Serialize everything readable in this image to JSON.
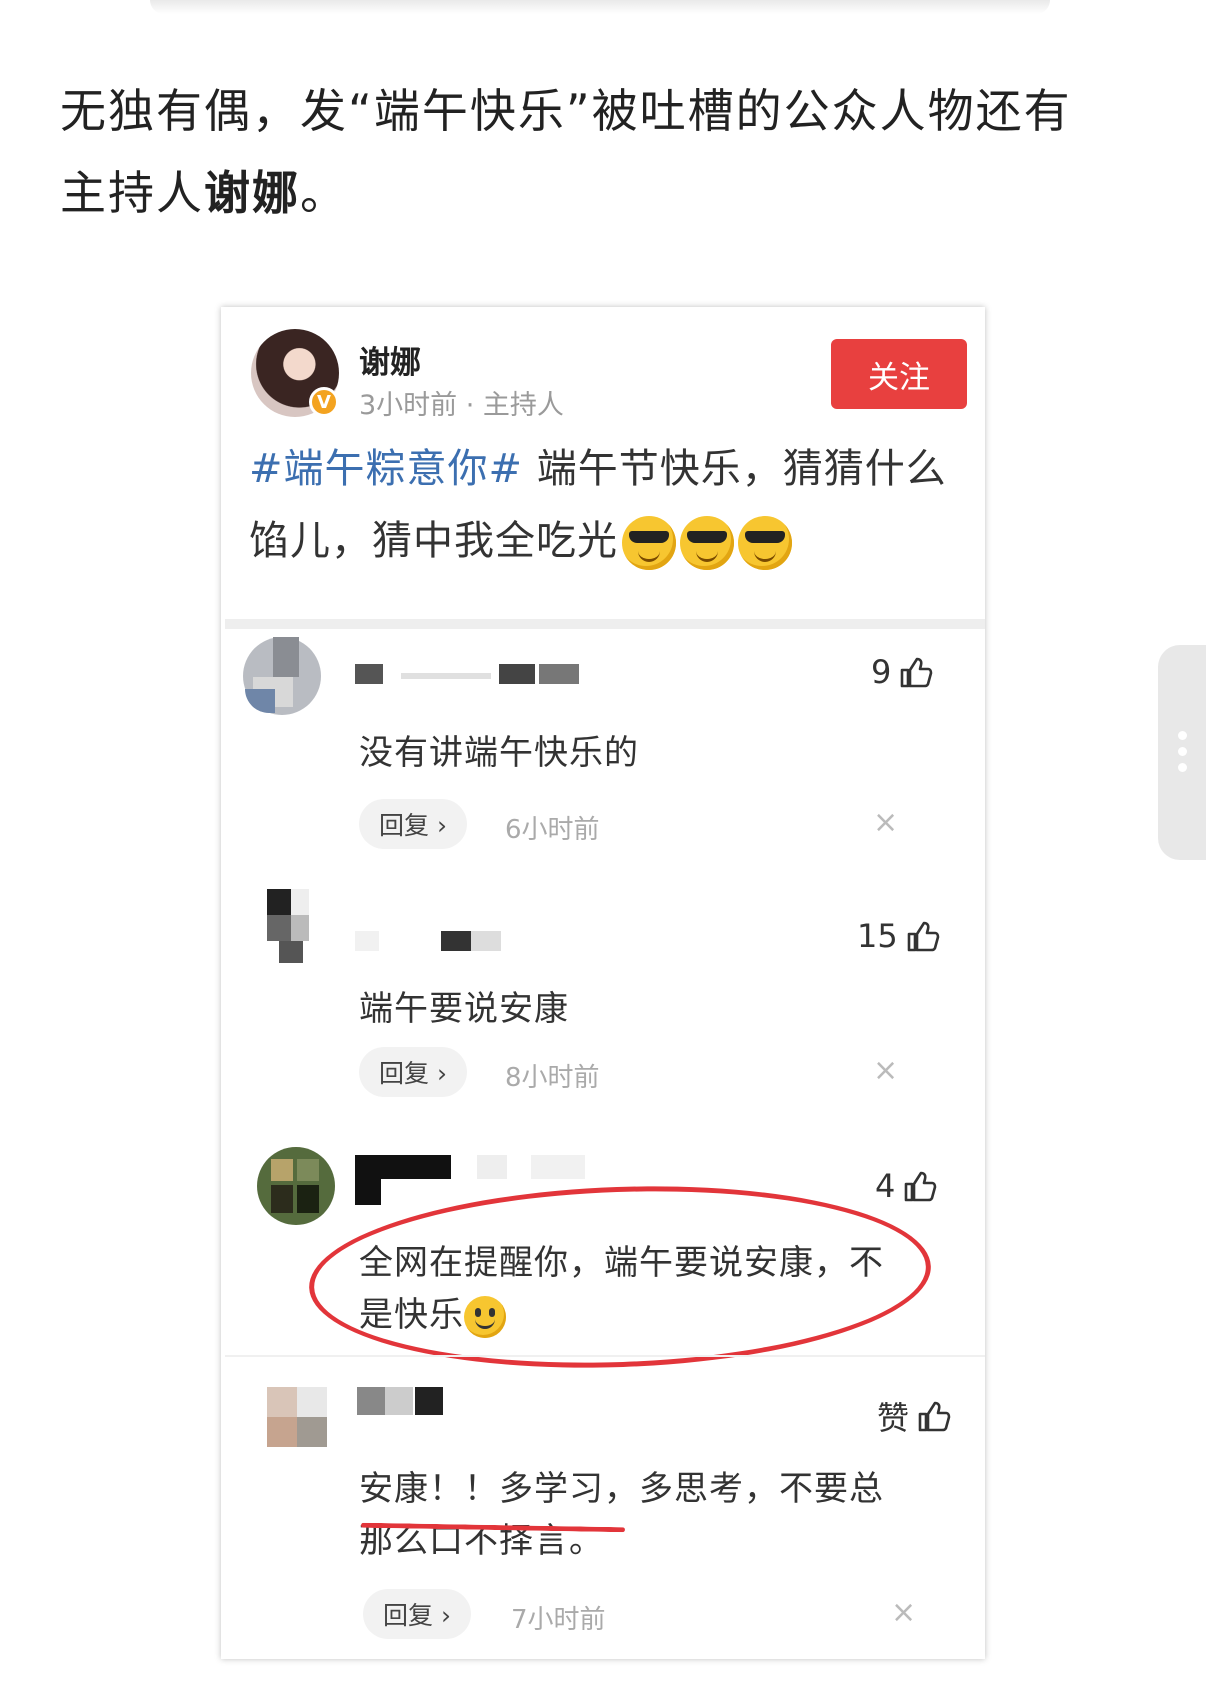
{
  "article": {
    "line1": "无独有偶，发“端午快乐”被吐槽的公众人物还有",
    "line2_prefix": "主持人",
    "line2_bold": "谢娜",
    "line2_suffix": "。"
  },
  "post": {
    "author": "谢娜",
    "meta": "3小时前 · 主持人",
    "follow_label": "关注",
    "badge": "V",
    "hashtag": "#端午粽意你#",
    "text": " 端午节快乐，猜猜什么馅儿，猜中我全吃光"
  },
  "comments": [
    {
      "likes": "9",
      "text": "没有讲端午快乐的",
      "reply_label": "回复 ›",
      "time": "6小时前",
      "close": "×"
    },
    {
      "likes": "15",
      "text": "端午要说安康",
      "reply_label": "回复 ›",
      "time": "8小时前",
      "close": "×"
    },
    {
      "likes": "4",
      "text_line1": "全网在提醒你，端午要说安康，不",
      "text_line2": "是快乐"
    },
    {
      "likes": "赞",
      "text_line1": "安康！！多学习，多思考，不要总",
      "text_line2": "那么口不择言。",
      "reply_label": "回复 ›",
      "time": "7小时前",
      "close": "×"
    }
  ],
  "colors": {
    "accent_red": "#e8403f",
    "hashtag_blue": "#3c6fb0",
    "annotation_red": "#e2353a"
  },
  "icons": [
    "thumbs-up-icon",
    "close-icon",
    "verified-badge-icon",
    "more-dots-icon"
  ]
}
